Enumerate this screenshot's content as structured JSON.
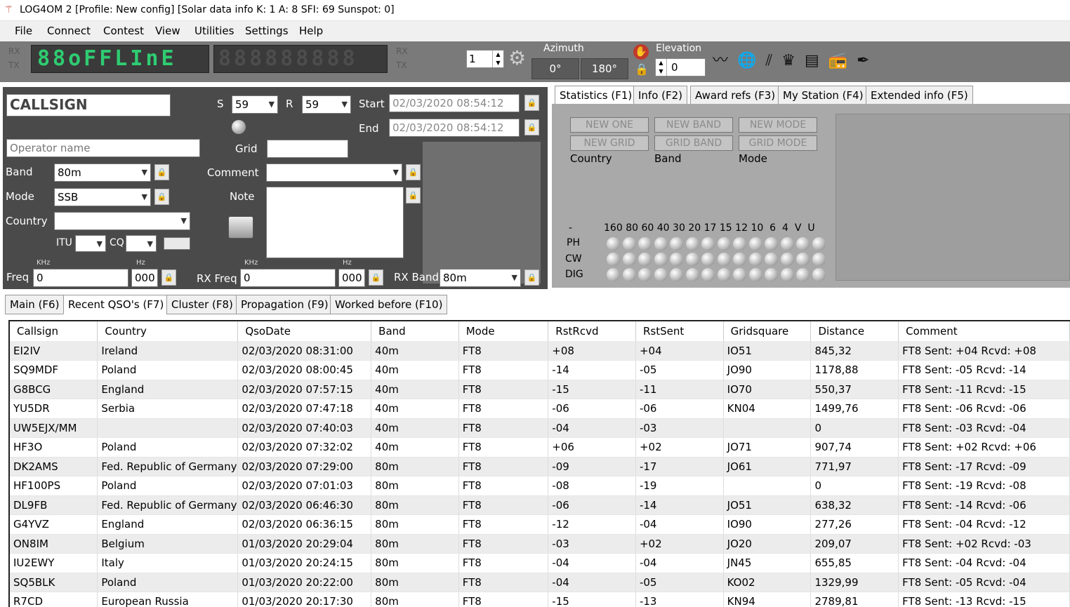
{
  "window": {
    "title": "LOG4OM 2 [Profile: New config] [Solar data info K: 1 A: 8 SFI: 69 Sunspot: 0]"
  },
  "menu": [
    "File",
    "Connect",
    "Contest",
    "View",
    "Utilities",
    "Settings",
    "Help"
  ],
  "toolbar": {
    "rx": "RX",
    "tx": "TX",
    "display_left": "88oFFLInE",
    "display_right": "888888888",
    "spin_value": "1",
    "azimuth_label": "Azimuth",
    "az_btn1": "0°",
    "az_btn2": "180°",
    "elevation_label": "Elevation",
    "elevation_value": "0"
  },
  "qso": {
    "callsign": "CALLSIGN",
    "s_label": "S",
    "s_value": "59",
    "r_label": "R",
    "r_value": "59",
    "start_label": "Start",
    "start_value": "02/03/2020 08:54:12",
    "end_label": "End",
    "end_value": "02/03/2020 08:54:12",
    "operator_placeholder": "Operator name",
    "grid_label": "Grid",
    "band_label": "Band",
    "band_value": "80m",
    "comment_label": "Comment",
    "mode_label": "Mode",
    "mode_value": "SSB",
    "note_label": "Note",
    "country_label": "Country",
    "itu_label": "ITU",
    "cq_label": "CQ",
    "khz": "KHz",
    "hz": "Hz",
    "freq_label": "Freq",
    "freq_khz": "0",
    "freq_hz": "000",
    "rxfreq_label": "RX Freq",
    "rxfreq_khz": "0",
    "rxfreq_hz": "000",
    "rxband_label": "RX Band",
    "rxband_value": "80m"
  },
  "info_tabs": [
    "Statistics (F1)",
    "Info (F2)",
    "Award refs (F3)",
    "My Station (F4)",
    "Extended info (F5)"
  ],
  "stats": {
    "buttons_row1": [
      "NEW ONE",
      "NEW BAND",
      "NEW MODE"
    ],
    "buttons_row2": [
      "NEW GRID",
      "GRID BAND",
      "GRID MODE"
    ],
    "captions": [
      "Country",
      "Band",
      "Mode"
    ],
    "dash": "-",
    "bands": [
      "160",
      "80",
      "60",
      "40",
      "30",
      "20",
      "17",
      "15",
      "12",
      "10",
      "6",
      "4",
      "V",
      "U"
    ],
    "rows": [
      "PH",
      "CW",
      "DIG"
    ]
  },
  "bottom_tabs": [
    "Main (F6)",
    "Recent QSO's (F7)",
    "Cluster (F8)",
    "Propagation (F9)",
    "Worked before (F10)"
  ],
  "table": {
    "columns": [
      "Callsign",
      "Country",
      "QsoDate",
      "Band",
      "Mode",
      "RstRcvd",
      "RstSent",
      "Gridsquare",
      "Distance",
      "Comment"
    ],
    "rows": [
      [
        "EI2IV",
        "Ireland",
        "02/03/2020 08:31:00",
        "40m",
        "FT8",
        "+08",
        "+04",
        "IO51",
        "845,32",
        "FT8  Sent: +04  Rcvd: +08"
      ],
      [
        "SQ9MDF",
        "Poland",
        "02/03/2020 08:00:45",
        "40m",
        "FT8",
        "-14",
        "-05",
        "JO90",
        "1178,88",
        "FT8  Sent: -05  Rcvd: -14"
      ],
      [
        "G8BCG",
        "England",
        "02/03/2020 07:57:15",
        "40m",
        "FT8",
        "-15",
        "-11",
        "IO70",
        "550,37",
        "FT8  Sent: -11  Rcvd: -15"
      ],
      [
        "YU5DR",
        "Serbia",
        "02/03/2020 07:47:18",
        "40m",
        "FT8",
        "-06",
        "-06",
        "KN04",
        "1499,76",
        "FT8  Sent: -06  Rcvd: -06"
      ],
      [
        "UW5EJX/MM",
        "",
        "02/03/2020 07:40:03",
        "40m",
        "FT8",
        "-04",
        "-03",
        "",
        "0",
        "FT8  Sent: -03  Rcvd: -04"
      ],
      [
        "HF3O",
        "Poland",
        "02/03/2020 07:32:02",
        "40m",
        "FT8",
        "+06",
        "+02",
        "JO71",
        "907,74",
        "FT8  Sent: +02  Rcvd: +06"
      ],
      [
        "DK2AMS",
        "Fed. Republic of Germany",
        "02/03/2020 07:29:00",
        "80m",
        "FT8",
        "-09",
        "-17",
        "JO61",
        "771,97",
        "FT8  Sent: -17  Rcvd: -09"
      ],
      [
        "HF100PS",
        "Poland",
        "02/03/2020 07:01:03",
        "80m",
        "FT8",
        "-08",
        "-19",
        "",
        "0",
        "FT8  Sent: -19  Rcvd: -08"
      ],
      [
        "DL9FB",
        "Fed. Republic of Germany",
        "02/03/2020 06:46:30",
        "80m",
        "FT8",
        "-06",
        "-14",
        "JO51",
        "638,32",
        "FT8  Sent: -14  Rcvd: -06"
      ],
      [
        "G4YVZ",
        "England",
        "02/03/2020 06:36:15",
        "80m",
        "FT8",
        "-12",
        "-04",
        "IO90",
        "277,26",
        "FT8  Sent: -04  Rcvd: -12"
      ],
      [
        "ON8IM",
        "Belgium",
        "01/03/2020 20:29:04",
        "80m",
        "FT8",
        "-03",
        "+02",
        "JO20",
        "209,07",
        "FT8  Sent: +02  Rcvd: -03"
      ],
      [
        "IU2EWY",
        "Italy",
        "01/03/2020 20:24:15",
        "80m",
        "FT8",
        "-04",
        "-04",
        "JN45",
        "655,85",
        "FT8  Sent: -04  Rcvd: -04"
      ],
      [
        "SQ5BLK",
        "Poland",
        "01/03/2020 20:22:00",
        "80m",
        "FT8",
        "-04",
        "-05",
        "KO02",
        "1329,99",
        "FT8  Sent: -05  Rcvd: -04"
      ],
      [
        "R7CD",
        "European Russia",
        "01/03/2020 20:17:30",
        "80m",
        "FT8",
        "-15",
        "-13",
        "KN94",
        "2789,81",
        "FT8  Sent: -13  Rcvd: -15"
      ]
    ]
  }
}
